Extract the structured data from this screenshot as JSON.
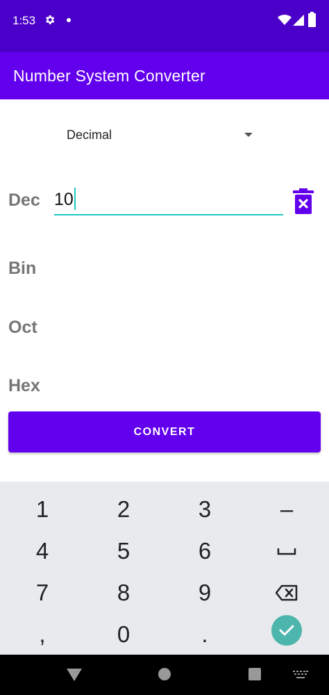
{
  "status_bar": {
    "time": "1:53",
    "icons": [
      "gear-icon",
      "dot-icon",
      "wifi-icon",
      "signal-icon",
      "battery-icon"
    ]
  },
  "app_bar": {
    "title": "Number System Converter"
  },
  "spinner": {
    "selected": "Decimal"
  },
  "rows": {
    "dec": {
      "label": "Dec",
      "value": "10"
    },
    "bin": {
      "label": "Bin"
    },
    "oct": {
      "label": "Oct"
    },
    "hex": {
      "label": "Hex"
    }
  },
  "convert_button": {
    "label": "CONVERT"
  },
  "keyboard": {
    "keys": [
      "1",
      "2",
      "3",
      "–",
      "4",
      "5",
      "6",
      "␣",
      "7",
      "8",
      "9",
      "⌫",
      ",",
      "0",
      ".",
      "✓"
    ]
  },
  "colors": {
    "status_bar": "#4a00c8",
    "primary": "#6200ee",
    "accent": "#1dc7c1",
    "label_gray": "#757575",
    "keyboard_bg": "#e8eaed",
    "done_key": "#4db6ac"
  }
}
